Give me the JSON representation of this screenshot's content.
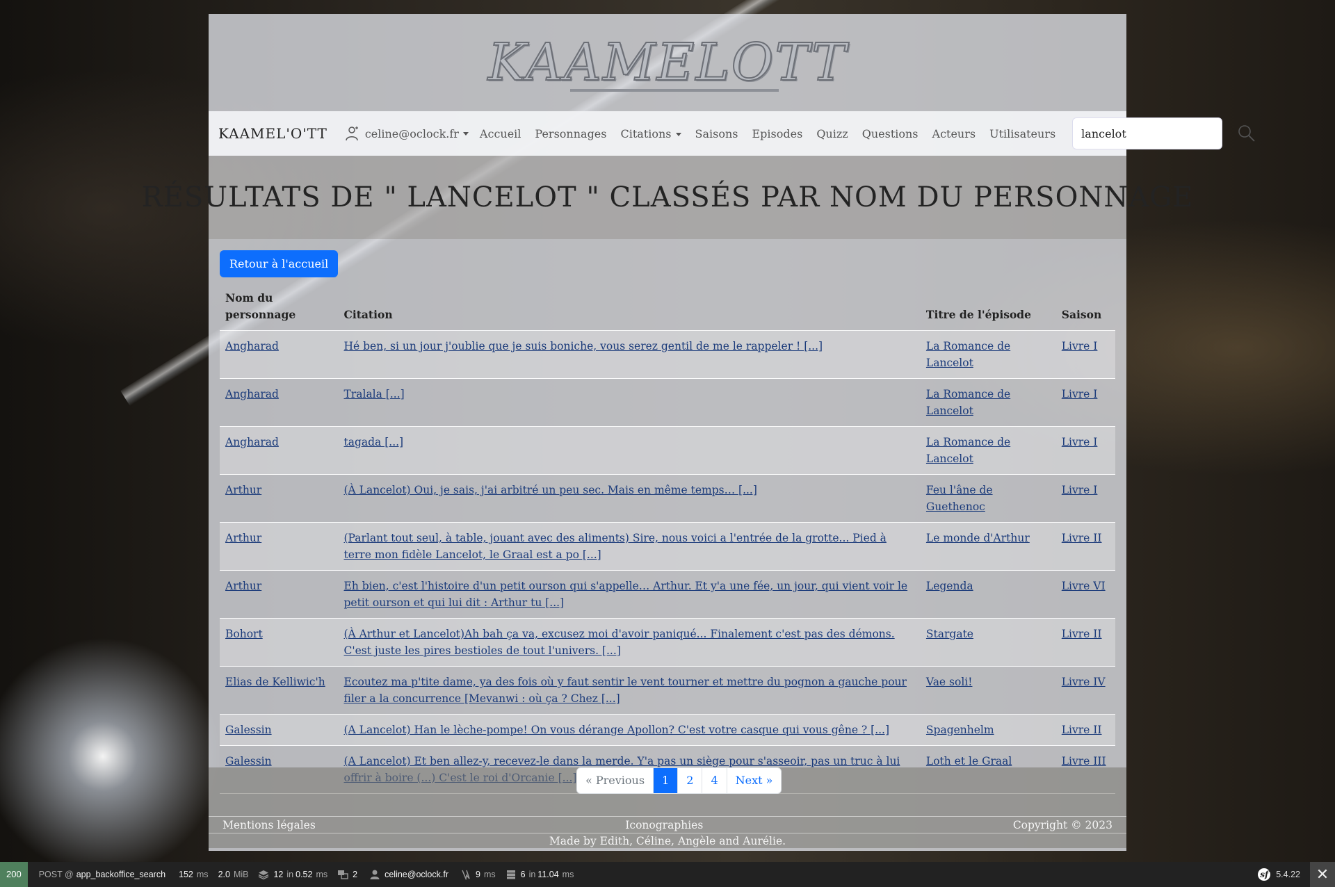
{
  "header": {
    "logo_text": "KAAMELOTT"
  },
  "nav": {
    "brand": "KAAMEL'O'TT",
    "user": "celine@oclock.fr",
    "links": [
      "Accueil",
      "Personnages",
      "Citations",
      "Saisons",
      "Episodes",
      "Quizz",
      "Questions",
      "Acteurs",
      "Utilisateurs"
    ],
    "search_value": "lancelot"
  },
  "page": {
    "title": "Résultats de \" lancelot \" classés par nom du personnage",
    "back_button": "Retour à l'accueil"
  },
  "table": {
    "headers": [
      "Nom du personnage",
      "Citation",
      "Titre de l'épisode",
      "Saison"
    ],
    "rows": [
      {
        "name": "Angharad",
        "quote": "Hé ben, si un jour j'oublie que je suis boniche, vous serez gentil de me le rappeler ! [...]",
        "episode": "La Romance de Lancelot",
        "season": "Livre I"
      },
      {
        "name": "Angharad",
        "quote": "Tralala [...]",
        "episode": "La Romance de Lancelot",
        "season": "Livre I"
      },
      {
        "name": "Angharad",
        "quote": "tagada [...]",
        "episode": "La Romance de Lancelot",
        "season": "Livre I"
      },
      {
        "name": "Arthur",
        "quote": "(À Lancelot) Oui, je sais, j'ai arbitré un peu sec. Mais en même temps… [...]",
        "episode": "Feu l'âne de Guethenoc",
        "season": "Livre I"
      },
      {
        "name": "Arthur",
        "quote": "(Parlant tout seul, à table, jouant avec des aliments) Sire, nous voici a l'entrée de la grotte... Pied à terre mon fidèle Lancelot, le Graal est a po [...]",
        "episode": "Le monde d'Arthur",
        "season": "Livre II"
      },
      {
        "name": "Arthur",
        "quote": "Eh bien, c'est l'histoire d'un petit ourson qui s'appelle… Arthur. Et y'a une fée, un jour, qui vient voir le petit ourson et qui lui dit : Arthur tu [...]",
        "episode": "Legenda",
        "season": "Livre VI"
      },
      {
        "name": "Bohort",
        "quote": "(À Arthur et Lancelot)Ah bah ça va, excusez moi d'avoir paniqué... Finalement c'est pas des démons. C'est juste les pires bestioles de tout l'univers. [...]",
        "episode": "Stargate",
        "season": "Livre II"
      },
      {
        "name": "Elias de Kelliwic'h",
        "quote": "Ecoutez ma p'tite dame, ya des fois où y faut sentir le vent tourner et mettre du pognon a gauche pour filer a la concurrence [Mevanwi : où ça ? Chez [...]",
        "episode": "Vae soli!",
        "season": "Livre IV"
      },
      {
        "name": "Galessin",
        "quote": "(A Lancelot) Han le lèche-pompe! On vous dérange Apollon? C'est votre casque qui vous gêne ? [...]",
        "episode": "Spagenhelm",
        "season": "Livre II"
      },
      {
        "name": "Galessin",
        "quote": "(A Lancelot) Et ben allez-y, recevez-le dans la merde. Y'a pas un siège pour s'asseoir, pas un truc à lui offrir à boire (...) C'est le roi d'Orcanie [...]",
        "episode": "Loth et le Graal",
        "season": "Livre III"
      }
    ]
  },
  "pagination": {
    "previous": "« Previous",
    "pages": [
      "1",
      "2",
      "4"
    ],
    "active": "1",
    "next": "Next »"
  },
  "footer": {
    "left": "Mentions légales",
    "center": "Iconographies",
    "right": "Copyright © 2023",
    "credit": "Made by Edith, Céline, Angèle and Aurélie."
  },
  "debug_toolbar": {
    "status": "200",
    "method": "POST @",
    "route": "app_backoffice_search",
    "time": "152",
    "time_unit": "ms",
    "memory": "2.0",
    "memory_unit": "MiB",
    "twig_count": "12",
    "twig_in": "in",
    "twig_time": "0.52",
    "twig_unit": "ms",
    "translations": "2",
    "user": "celine@oclock.fr",
    "events_time": "9",
    "events_unit": "ms",
    "db_count": "6",
    "db_in": "in",
    "db_time": "11.04",
    "db_unit": "ms",
    "version": "5.4.22"
  }
}
